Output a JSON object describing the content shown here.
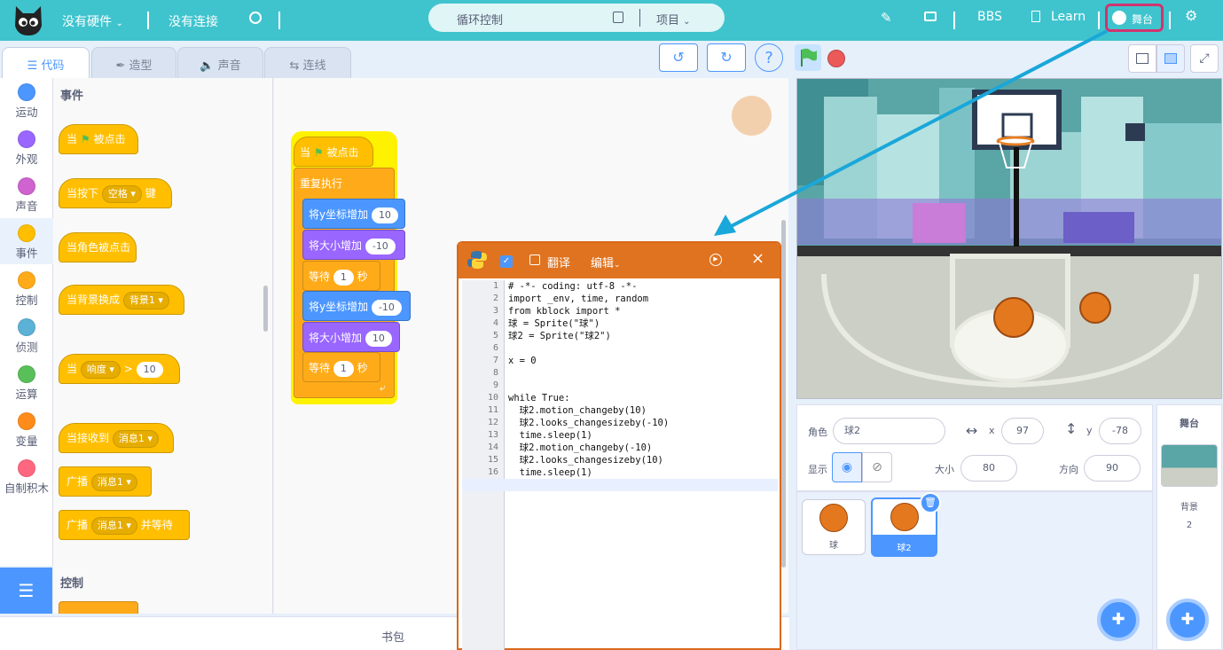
{
  "topbar": {
    "hardware": "没有硬件",
    "connection": "没有连接",
    "project_name": "循环控制",
    "project_menu": "项目",
    "bbs": "BBS",
    "learn": "Learn",
    "stage_toggle": "舞台"
  },
  "tabs": [
    "代码",
    "造型",
    "声音",
    "连线"
  ],
  "categories": [
    {
      "label": "运动",
      "color": "#4c97ff"
    },
    {
      "label": "外观",
      "color": "#9966ff"
    },
    {
      "label": "声音",
      "color": "#cf63cf"
    },
    {
      "label": "事件",
      "color": "#ffbf00"
    },
    {
      "label": "控制",
      "color": "#ffab19"
    },
    {
      "label": "侦测",
      "color": "#5cb1d6"
    },
    {
      "label": "运算",
      "color": "#59c059"
    },
    {
      "label": "变量",
      "color": "#ff8c1a"
    },
    {
      "label": "自制积木",
      "color": "#ff6680"
    }
  ],
  "palette": {
    "section_events": "事件",
    "section_control": "控制",
    "blocks": {
      "when": "当",
      "clicked": "被点击",
      "when_key": "当按下",
      "key_value": "空格",
      "key_suffix": "键",
      "when_sprite_clicked": "当角色被点击",
      "when_backdrop": "当背景换成",
      "backdrop_value": "背景1",
      "loudness": "响度",
      "gt": ">",
      "loudness_value": "10",
      "when_receive": "当接收到",
      "msg_value": "消息1",
      "broadcast": "广播",
      "broadcast_wait_suffix": "并等待"
    }
  },
  "script": {
    "hat_when": "当",
    "hat_clicked": "被点击",
    "forever": "重复执行",
    "y_change": "将y坐标增加",
    "size_change": "将大小增加",
    "wait": "等待",
    "seconds": "秒",
    "v1": "10",
    "v2": "-10",
    "v3": "1",
    "v4": "-10",
    "v5": "10",
    "v6": "1"
  },
  "editor": {
    "translate": "翻译",
    "edit": "编辑",
    "line_numbers": [
      "1",
      "2",
      "3",
      "4",
      "5",
      "6",
      "7",
      "8",
      "9",
      "10",
      "11",
      "12",
      "13",
      "14",
      "15",
      "16",
      "17"
    ],
    "code": [
      "# -*- coding: utf-8 -*-",
      "import _env, time, random",
      "from kblock import *",
      "球 = Sprite(\"球\")",
      "球2 = Sprite(\"球2\")",
      "",
      "x = 0",
      "",
      "",
      "while True:",
      "  球2.motion_changeby(10)",
      "  球2.looks_changesizeby(-10)",
      "  time.sleep(1)",
      "  球2.motion_changeby(-10)",
      "  球2.looks_changesizeby(10)",
      "  time.sleep(1)",
      ""
    ]
  },
  "sprite_info": {
    "sprite_label": "角色",
    "sprite_name": "球2",
    "x_label": "x",
    "x_value": "97",
    "y_label": "y",
    "y_value": "-78",
    "show_label": "显示",
    "size_label": "大小",
    "size_value": "80",
    "direction_label": "方向",
    "direction_value": "90"
  },
  "sprites": [
    "球",
    "球2"
  ],
  "stage_panel": {
    "title": "舞台",
    "backdrop_label": "背景",
    "backdrop_count": "2"
  },
  "backpack": "书包",
  "colors": {
    "topbar": "#3fc4ce",
    "accent": "#4c97ff",
    "editor": "#e0731f",
    "highlight": "#d2336f"
  }
}
